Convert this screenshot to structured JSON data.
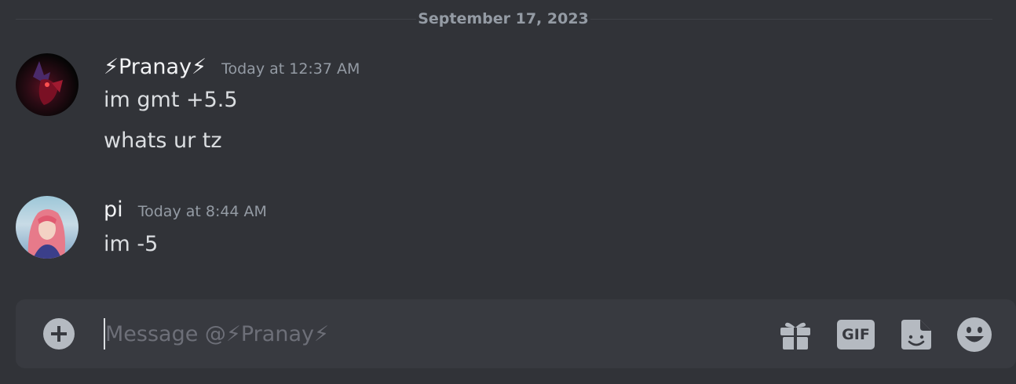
{
  "date_divider": "September 17, 2023",
  "messages": [
    {
      "username": "⚡Pranay⚡",
      "timestamp": "Today at 12:37 AM",
      "lines": [
        "im gmt +5.5",
        "whats ur tz"
      ]
    },
    {
      "username": "pi",
      "timestamp": "Today at 8:44 AM",
      "lines": [
        "im -5"
      ]
    }
  ],
  "composer": {
    "placeholder": "Message @⚡Pranay⚡",
    "value": "",
    "gif_label": "GIF",
    "icons": [
      "plus-circle-icon",
      "gift-icon",
      "gif-icon",
      "sticker-icon",
      "emoji-icon"
    ]
  },
  "colors": {
    "background": "#313338",
    "composer": "#383a40",
    "username": "#f2f3f5",
    "timestamp": "#949ba4",
    "icon": "#b5bac1"
  }
}
